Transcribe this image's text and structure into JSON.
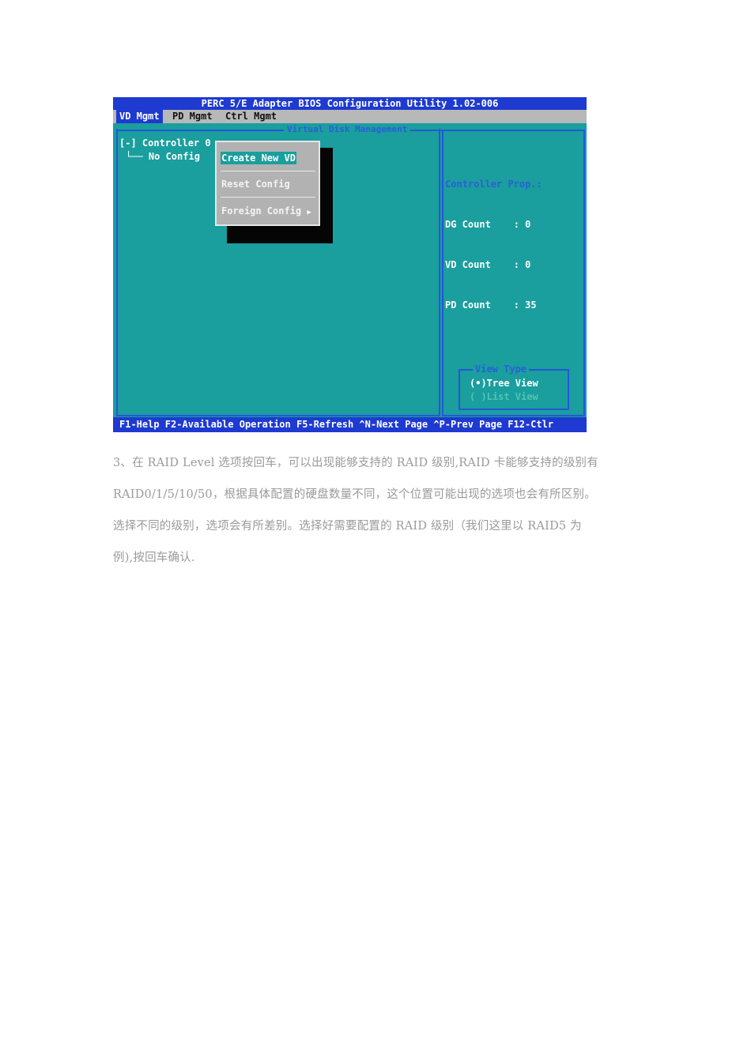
{
  "bios": {
    "title": "PERC 5/E Adapter BIOS Configuration Utility 1.02-006",
    "tabs": [
      "VD Mgmt",
      "PD Mgmt",
      "Ctrl Mgmt"
    ],
    "panel_title": "Virtual Disk Management",
    "tree": {
      "controller": "[-] Controller 0",
      "no_config": "└── No Config"
    },
    "menu": {
      "items": [
        "Create New VD",
        "Reset Config",
        "Foreign Config"
      ],
      "submenu_arrow": "▶"
    },
    "props": {
      "heading": "Controller Prop.:",
      "rows": [
        "DG Count    : 0",
        "VD Count    : 0",
        "PD Count    : 35"
      ]
    },
    "view_type": {
      "title": "View Type",
      "tree_view": "(•)Tree View",
      "list_view": "( )List View"
    },
    "footer": "F1-Help F2-Available Operation F5-Refresh ^N-Next Page ^P-Prev Page F12-Ctlr",
    "colors": {
      "background": "#1a9e9e",
      "title_bar": "#1e3ad0",
      "menu": "#b2b2b2"
    }
  },
  "paragraph": {
    "lines": [
      "3、在 RAID Level 选项按回车，可以出现能够支持的 RAID 级别,RAID 卡能够支持的级别有",
      "RAID0/1/5/10/50，根据具体配置的硬盘数量不同，这个位置可能出现的选项也会有所区别。",
      "选择不同的级别，选项会有所差别。选择好需要配置的 RAID 级别（我们这里以 RAID5 为",
      "例),按回车确认."
    ]
  }
}
